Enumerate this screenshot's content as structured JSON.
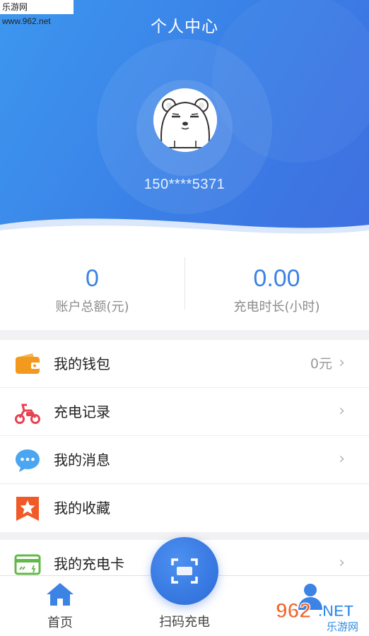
{
  "watermark": "乐游网 www.962.net",
  "header": {
    "title": "个人中心"
  },
  "profile": {
    "phone": "150****5371",
    "avatar_icon": "bear-avatar-icon"
  },
  "stats": [
    {
      "value": "0",
      "label": "账户总额(元)"
    },
    {
      "value": "0.00",
      "label": "充电时长(小时)"
    }
  ],
  "menu_group_1": [
    {
      "label": "我的钱包",
      "value": "0元",
      "icon": "wallet-icon",
      "chevron": "›"
    },
    {
      "label": "充电记录",
      "value": "",
      "icon": "scooter-icon",
      "chevron": "›"
    },
    {
      "label": "我的消息",
      "value": "",
      "icon": "message-icon",
      "chevron": "›"
    },
    {
      "label": "我的收藏",
      "value": "",
      "icon": "star-bookmark-icon",
      "chevron": ""
    }
  ],
  "menu_group_2": [
    {
      "label": "我的充电卡",
      "value": "",
      "icon": "card-icon",
      "chevron": "›"
    }
  ],
  "bottom_nav": {
    "home_label": "首页",
    "scan_label": "扫码充电",
    "profile_icon": "user-icon"
  },
  "corner_logo": {
    "text": "962.NET",
    "subtext": "乐游网"
  },
  "colors": {
    "accent": "#3b83e4",
    "wallet": "#f39a1e",
    "scooter": "#e8414f",
    "message": "#4aa6f0",
    "star": "#f05a28",
    "card": "#63b84a"
  }
}
